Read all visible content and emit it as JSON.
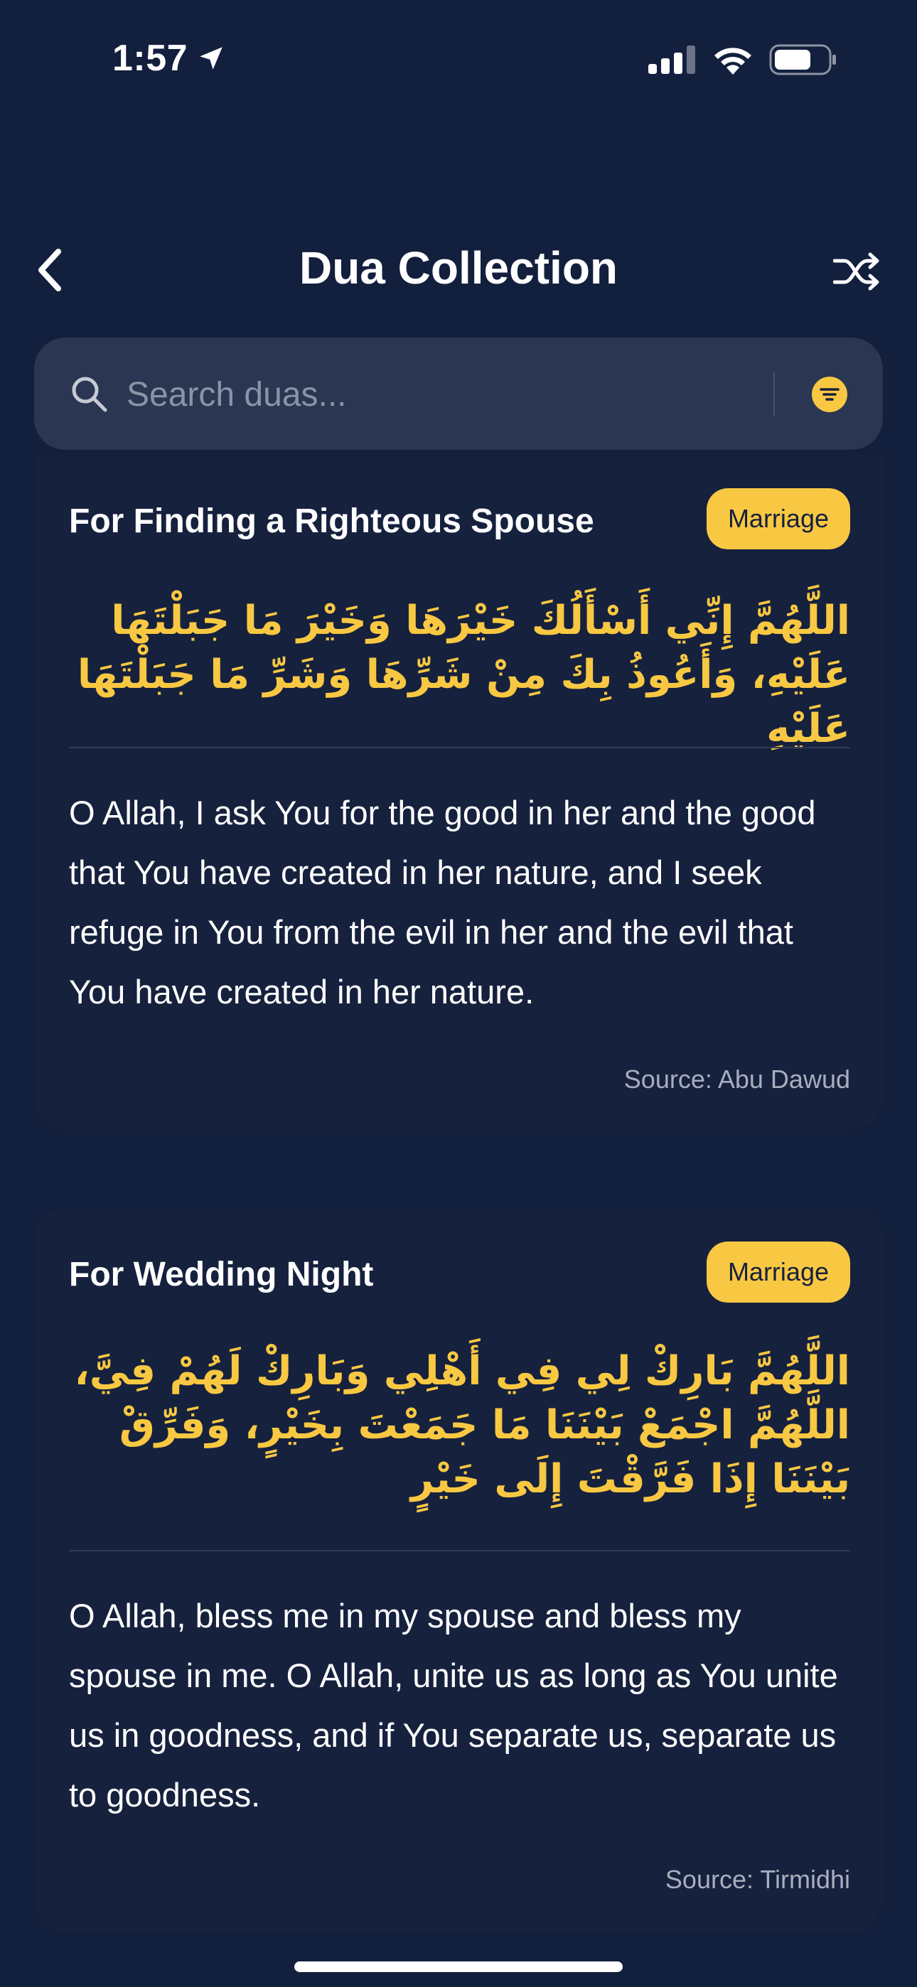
{
  "status_bar": {
    "time": "1:57",
    "icons": [
      "location-arrow-icon",
      "cellular-signal-icon",
      "wifi-icon",
      "battery-icon"
    ]
  },
  "header": {
    "title": "Dua Collection",
    "back_icon": "chevron-left-icon",
    "shuffle_icon": "shuffle-icon"
  },
  "search": {
    "placeholder": "Search duas...",
    "value": "",
    "icon": "search-icon",
    "filter_icon": "filter-icon"
  },
  "colors": {
    "background": "#121f3d",
    "card": "#16213e",
    "accent": "#f8c842",
    "search_bg": "#2a3652"
  },
  "duas": [
    {
      "title": "For Finding a Righteous Spouse",
      "category": "Marriage",
      "arabic": "اللَّهُمَّ إِنِّي أَسْأَلُكَ خَيْرَهَا وَخَيْرَ مَا جَبَلْتَهَا عَلَيْهِ، وَأَعُوذُ بِكَ مِنْ شَرِّهَا وَشَرِّ مَا جَبَلْتَهَا عَلَيْهِ",
      "translation": "O Allah, I ask You for the good in her and the good that You have created in her nature, and I seek refuge in You from the evil in her and the evil that You have created in her nature.",
      "source": "Source: Abu Dawud"
    },
    {
      "title": "For Wedding Night",
      "category": "Marriage",
      "arabic": "اللَّهُمَّ بَارِكْ لِي فِي أَهْلِي وَبَارِكْ لَهُمْ فِيَّ، اللَّهُمَّ اجْمَعْ بَيْنَنَا مَا جَمَعْتَ بِخَيْرٍ، وَفَرِّقْ بَيْنَنَا إِذَا فَرَّقْتَ إِلَى خَيْرٍ",
      "translation": "O Allah, bless me in my spouse and bless my spouse in me. O Allah, unite us as long as You unite us in goodness, and if You separate us, separate us to goodness.",
      "source": "Source: Tirmidhi"
    }
  ]
}
